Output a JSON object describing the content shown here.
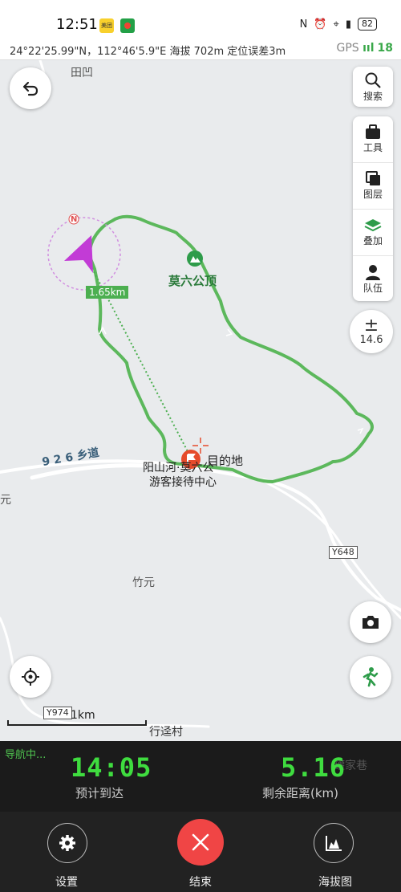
{
  "status_bar": {
    "time": "12:51",
    "app1_label": "美团",
    "battery": "82"
  },
  "info_bar": {
    "coords": "24°22'25.99\"N，112°46'5.9\"E",
    "altitude": "海拔 702m",
    "accuracy": "定位误差3m",
    "gps_label": "GPS",
    "gps_bars": "ııl",
    "gps_count": "18"
  },
  "map": {
    "labels": {
      "tianao": "田凹",
      "peak": "莫六公顶",
      "road926": "9 2 6 乡道",
      "destination_name_l1": "阳山河·莫六公",
      "destination_name_l2": "游客接待中心",
      "destination": "目的地",
      "zhuyuan": "竹元",
      "left_edge": "元",
      "xingjing": "行迳村",
      "road_y648": "Y648",
      "road_y974": "Y974"
    },
    "distance_tag": "1.65km",
    "scale_label": "1km",
    "compass_label": "N"
  },
  "buttons": {
    "search": "搜索",
    "tools": "工具",
    "layers": "图层",
    "overlay": "叠加",
    "team": "队伍",
    "zoom_level": "14.6",
    "zoom_symbol": "±"
  },
  "nav": {
    "status": "导航中...",
    "eta_value": "14:05",
    "eta_label": "预计到达",
    "distance_value": "5.16",
    "distance_label": "剩余距离(km)",
    "bg_place": "罐家巷"
  },
  "bottom": {
    "settings": "设置",
    "end": "结束",
    "elevation": "海拔图"
  },
  "colors": {
    "track": "#5cb85c",
    "accent_green": "#3fdc3f",
    "end_red": "#f04545",
    "arrow_magenta": "#c23bd6"
  }
}
